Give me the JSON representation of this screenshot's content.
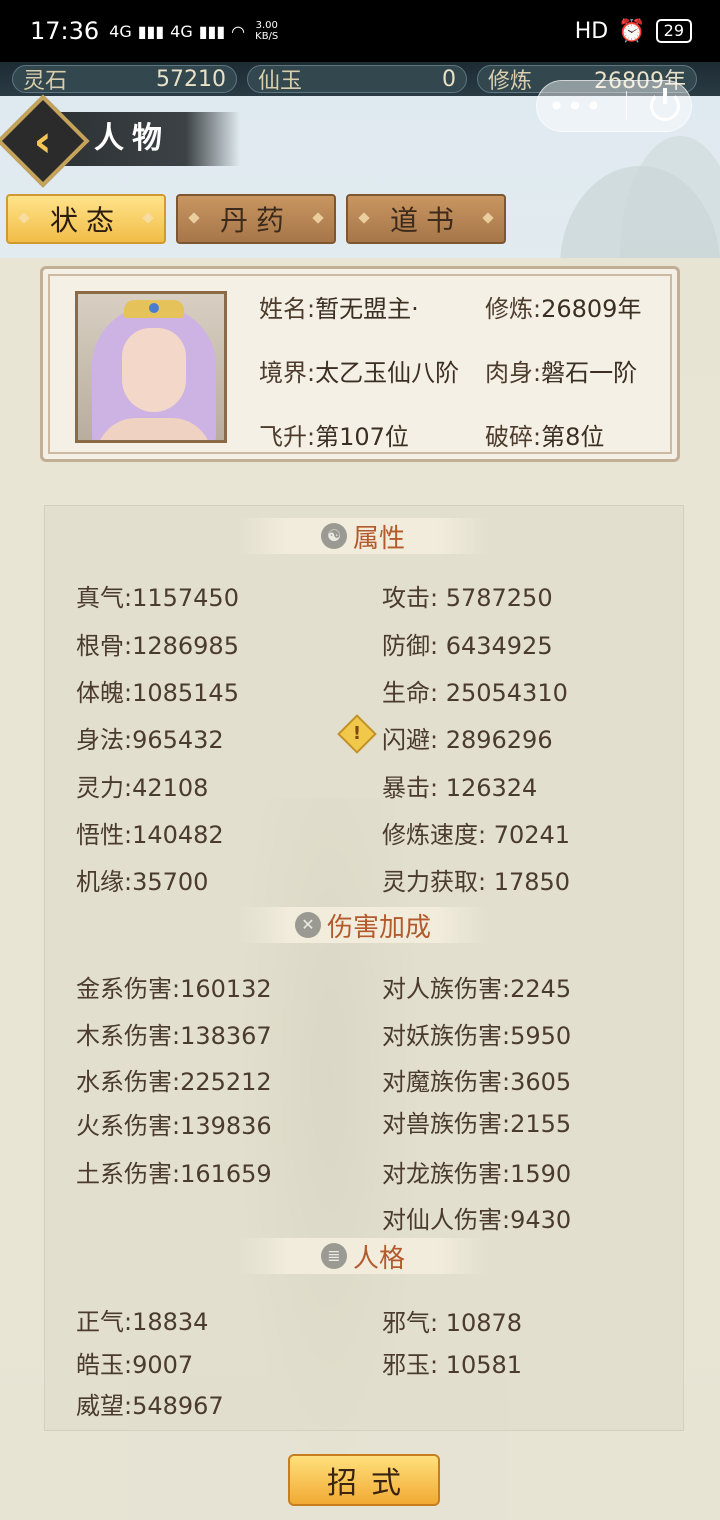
{
  "statusbar": {
    "time": "17:36",
    "net_speed": "3.00",
    "net_unit": "KB/S",
    "hd": "HD",
    "battery": "29",
    "sig1": "4G",
    "sig2": "4G"
  },
  "resources": {
    "lingshi_label": "灵石",
    "lingshi_value": "57210",
    "xianyu_label": "仙玉",
    "xianyu_value": "0",
    "xiulian_label": "修炼",
    "xiulian_value": "26809年"
  },
  "header": {
    "title": "人物"
  },
  "tabs": [
    "状态",
    "丹药",
    "道书"
  ],
  "profile": {
    "name_k": "姓名:",
    "name_v": "暂无盟主·",
    "cult_k": "修炼:",
    "cult_v": "26809年",
    "realm_k": "境界:",
    "realm_v": "太乙玉仙八阶",
    "body_k": "肉身:",
    "body_v": "磐石一阶",
    "ascend_k": "飞升:",
    "ascend_v": "第107位",
    "shatter_k": "破碎:",
    "shatter_v": "第8位"
  },
  "attributes": {
    "title": "属性",
    "left": [
      "真气:1157450",
      "根骨:1286985",
      "体魄:1085145",
      "身法:965432",
      "灵力:42108",
      "悟性:140482",
      "机缘:35700"
    ],
    "right": [
      "攻击: 5787250",
      "防御: 6434925",
      "生命: 25054310",
      "闪避: 2896296",
      "暴击: 126324",
      "修炼速度: 70241",
      "灵力获取: 17850"
    ]
  },
  "damage": {
    "title": "伤害加成",
    "left": [
      "金系伤害:160132",
      "木系伤害:138367",
      "水系伤害:225212",
      "火系伤害:139836",
      "土系伤害:161659"
    ],
    "right": [
      "对人族伤害:2245",
      "对妖族伤害:5950",
      "对魔族伤害:3605",
      "对兽族伤害:2155",
      "对龙族伤害:1590",
      "对仙人伤害:9430"
    ]
  },
  "personality": {
    "title": "人格",
    "left": [
      "正气:18834",
      "皓玉:9007",
      "威望:548967"
    ],
    "right": [
      "邪气: 10878",
      "邪玉: 10581"
    ]
  },
  "skill_button": "招式"
}
